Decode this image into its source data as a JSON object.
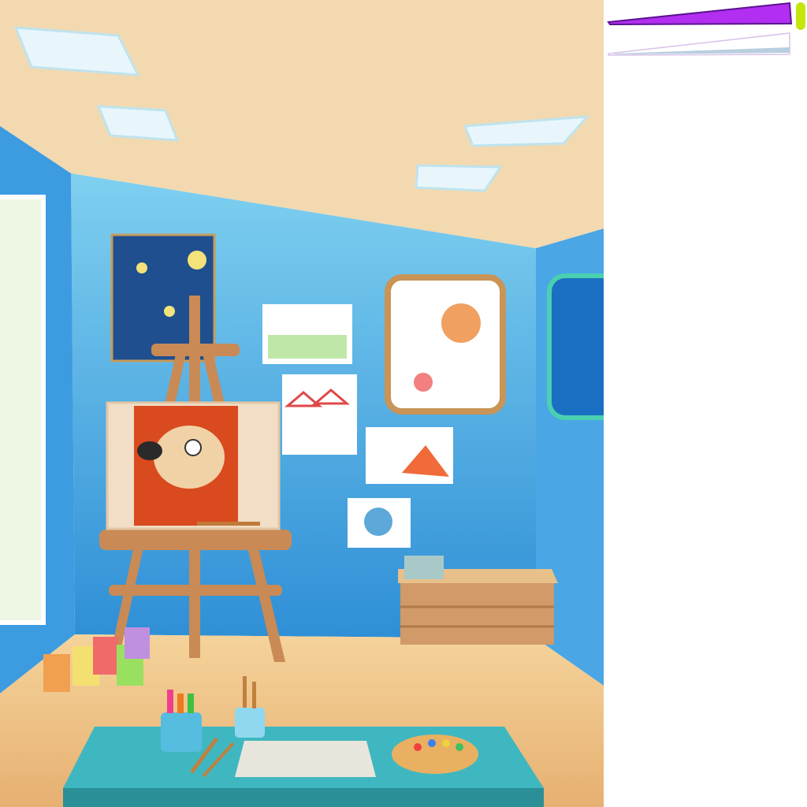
{
  "game": {
    "scene": "art-studio-room",
    "colors": {
      "ceiling": "#f3d9b0",
      "wall": "#5fb8e6",
      "floor": "#f2c98a",
      "accent_purple": "#b22ef0",
      "accent_lime": "#c4e60c",
      "table": "#3fb7c0"
    }
  },
  "panel": {
    "size_slider": {
      "value": 1.0,
      "color": "#b22ef0",
      "icon": "wedge-size-slider"
    },
    "opacity_slider": {
      "value": 0.0,
      "color": "#ffffff",
      "icon": "wedge-opacity-slider"
    },
    "color_swatch": {
      "color": "#c4e60c"
    }
  }
}
